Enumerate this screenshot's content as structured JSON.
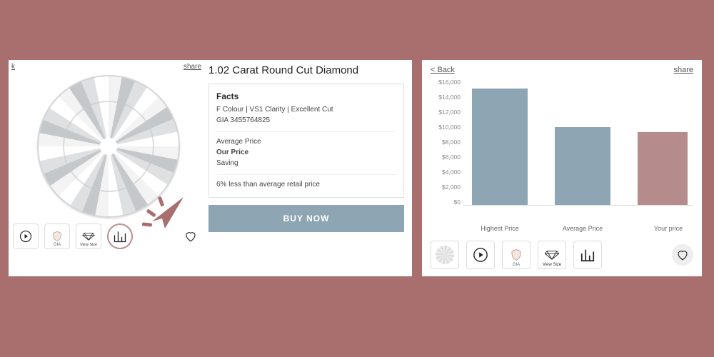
{
  "left": {
    "back_link": "k",
    "share_link": "share",
    "thumbs": {
      "play": "play-icon",
      "gia": "GIA",
      "view_size": "View Size",
      "chart": "bar-chart-icon"
    },
    "selected_thumb_index": 3
  },
  "product": {
    "title": "1.02 Carat Round Cut Diamond",
    "facts": {
      "heading": "Facts",
      "specs": "F Colour | VS1 Clarity | Excellent Cut",
      "cert": "GIA 3455764825",
      "avg_label": "Average Price",
      "our_label": "Our Price",
      "saving_label": "Saving",
      "savings_note": "6% less than average retail price"
    },
    "buy_label": "BUY NOW"
  },
  "right": {
    "back_link": "< Back",
    "share_link": "share",
    "thumbs": {
      "diamond": "diamond-thumb",
      "play": "play-icon",
      "gia": "GIA",
      "view_size": "View Size",
      "chart": "bar-chart-icon"
    }
  },
  "colors": {
    "bar_blue": "#8ea6b3",
    "bar_mauve": "#b58b8b"
  },
  "chart_data": {
    "type": "bar",
    "categories": [
      "Highest Price",
      "Average Price",
      "Your price"
    ],
    "values": [
      14500,
      9700,
      9100
    ],
    "series_colors": [
      "#8ea6b3",
      "#8ea6b3",
      "#b58b8b"
    ],
    "y_ticks": [
      "$16,000",
      "$14,000",
      "$12,000",
      "$10,000",
      "$8,000",
      "$6,000",
      "$4,000",
      "$2,000",
      "$0"
    ],
    "ylim": [
      0,
      16000
    ],
    "title": "",
    "xlabel": "",
    "ylabel": ""
  }
}
